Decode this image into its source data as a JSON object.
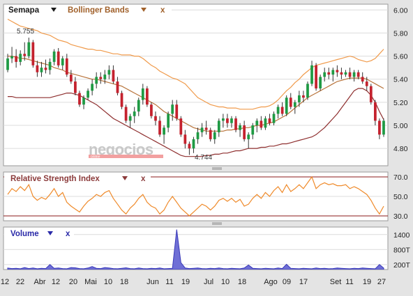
{
  "colors": {
    "bg": "#e4e4e4",
    "panel": "#ffffff",
    "grid": "#dcdcdc",
    "frame": "#9a9a9a",
    "upper_band": "#f09a4a",
    "middle_band": "#b8733a",
    "lower_band": "#8e2e2e",
    "up": "#1f9a44",
    "down": "#c4222e",
    "rsi": "#ef8a2a",
    "rsi_ref": "#8b1a1a",
    "volume": "#3a3ab8",
    "volume_fill": "#6f6fd6",
    "watermark_main": "#c8c8c8",
    "watermark_bar": "#f2a0a0"
  },
  "price_panel": {
    "legend": {
      "symbol": "Semapa",
      "indicator": "Bollinger Bands",
      "close": "x",
      "symbol_arrow": "chevron-down-icon",
      "indicator_arrow": "chevron-down-icon"
    },
    "ticks": [
      "6.00",
      "5.80",
      "5.60",
      "5.40",
      "5.20",
      "5.00",
      "4.80"
    ],
    "high_label": "5.755",
    "low_label": "4.744",
    "watermark": "negocios",
    "watermark_sub": "online"
  },
  "rsi_panel": {
    "legend": {
      "name": "Relative Strength Index",
      "close": "x",
      "arrow": "chevron-down-icon"
    },
    "ticks": [
      "70.0",
      "50.0",
      "30.0"
    ]
  },
  "volume_panel": {
    "legend": {
      "name": "Volume",
      "close": "x",
      "arrow": "chevron-down-icon"
    },
    "ticks": [
      "1400",
      "800T",
      "200T"
    ]
  },
  "x_axis": {
    "ticks": [
      "12",
      "22",
      "Abr",
      "12",
      "20",
      "Mai",
      "10",
      "18",
      "Jun",
      "11",
      "19",
      "Jul",
      "10",
      "18",
      "Ago",
      "09",
      "17",
      "Set",
      "11",
      "19",
      "27"
    ]
  },
  "chart_data": {
    "type": "candlestick",
    "y_range": [
      4.65,
      6.05
    ],
    "rsi_range": [
      25,
      75
    ],
    "rsi_reference_levels": [
      70,
      30
    ],
    "volume_range": [
      0,
      1700
    ],
    "candles": [
      [
        5.48,
        5.62,
        5.46,
        5.58
      ],
      [
        5.58,
        5.68,
        5.54,
        5.6
      ],
      [
        5.6,
        5.66,
        5.5,
        5.55
      ],
      [
        5.55,
        5.65,
        5.52,
        5.62
      ],
      [
        5.62,
        5.72,
        5.56,
        5.6
      ],
      [
        5.6,
        5.76,
        5.58,
        5.72
      ],
      [
        5.72,
        5.74,
        5.5,
        5.52
      ],
      [
        5.52,
        5.56,
        5.42,
        5.46
      ],
      [
        5.46,
        5.55,
        5.42,
        5.5
      ],
      [
        5.5,
        5.57,
        5.45,
        5.48
      ],
      [
        5.48,
        5.58,
        5.44,
        5.55
      ],
      [
        5.55,
        5.66,
        5.52,
        5.64
      ],
      [
        5.64,
        5.67,
        5.5,
        5.52
      ],
      [
        5.52,
        5.6,
        5.48,
        5.58
      ],
      [
        5.58,
        5.62,
        5.42,
        5.44
      ],
      [
        5.44,
        5.48,
        5.36,
        5.38
      ],
      [
        5.38,
        5.42,
        5.26,
        5.28
      ],
      [
        5.28,
        5.3,
        5.16,
        5.18
      ],
      [
        5.18,
        5.26,
        5.14,
        5.24
      ],
      [
        5.24,
        5.32,
        5.22,
        5.3
      ],
      [
        5.3,
        5.4,
        5.26,
        5.36
      ],
      [
        5.36,
        5.46,
        5.32,
        5.42
      ],
      [
        5.42,
        5.46,
        5.36,
        5.4
      ],
      [
        5.4,
        5.48,
        5.36,
        5.44
      ],
      [
        5.44,
        5.52,
        5.4,
        5.48
      ],
      [
        5.48,
        5.52,
        5.36,
        5.38
      ],
      [
        5.38,
        5.42,
        5.26,
        5.28
      ],
      [
        5.28,
        5.3,
        5.14,
        5.16
      ],
      [
        5.16,
        5.18,
        5.02,
        5.04
      ],
      [
        5.04,
        5.1,
        4.98,
        5.08
      ],
      [
        5.08,
        5.16,
        5.02,
        5.12
      ],
      [
        5.12,
        5.24,
        5.08,
        5.22
      ],
      [
        5.22,
        5.36,
        5.18,
        5.32
      ],
      [
        5.32,
        5.34,
        5.16,
        5.18
      ],
      [
        5.18,
        5.2,
        5.06,
        5.08
      ],
      [
        5.08,
        5.12,
        5.0,
        5.04
      ],
      [
        5.04,
        5.08,
        4.9,
        4.92
      ],
      [
        4.92,
        5.0,
        4.84,
        4.98
      ],
      [
        4.98,
        5.12,
        4.94,
        5.1
      ],
      [
        5.1,
        5.22,
        5.04,
        5.18
      ],
      [
        5.18,
        5.22,
        5.04,
        5.06
      ],
      [
        5.06,
        5.08,
        4.9,
        4.92
      ],
      [
        4.92,
        4.96,
        4.8,
        4.84
      ],
      [
        4.84,
        4.86,
        4.744,
        4.8
      ],
      [
        4.8,
        4.9,
        4.76,
        4.88
      ],
      [
        4.88,
        4.98,
        4.84,
        4.94
      ],
      [
        4.94,
        5.02,
        4.9,
        4.98
      ],
      [
        4.98,
        5.04,
        4.92,
        4.96
      ],
      [
        4.96,
        4.98,
        4.86,
        4.88
      ],
      [
        4.88,
        4.96,
        4.84,
        4.94
      ],
      [
        4.94,
        5.06,
        4.9,
        5.04
      ],
      [
        5.04,
        5.1,
        4.98,
        5.06
      ],
      [
        5.06,
        5.1,
        4.98,
        5.02
      ],
      [
        5.02,
        5.08,
        4.98,
        5.06
      ],
      [
        5.06,
        5.08,
        4.94,
        4.96
      ],
      [
        4.96,
        5.02,
        4.9,
        5.0
      ],
      [
        5.0,
        5.04,
        4.86,
        4.88
      ],
      [
        4.88,
        4.94,
        4.8,
        4.92
      ],
      [
        4.92,
        5.02,
        4.88,
        5.0
      ],
      [
        5.0,
        5.06,
        4.94,
        5.04
      ],
      [
        5.04,
        5.08,
        4.96,
        4.98
      ],
      [
        4.98,
        5.08,
        4.96,
        5.06
      ],
      [
        5.06,
        5.1,
        5.0,
        5.02
      ],
      [
        5.02,
        5.12,
        5.0,
        5.1
      ],
      [
        5.1,
        5.18,
        5.06,
        5.16
      ],
      [
        5.16,
        5.2,
        5.08,
        5.1
      ],
      [
        5.1,
        5.26,
        5.08,
        5.24
      ],
      [
        5.24,
        5.28,
        5.14,
        5.16
      ],
      [
        5.16,
        5.22,
        5.1,
        5.2
      ],
      [
        5.2,
        5.3,
        5.16,
        5.26
      ],
      [
        5.26,
        5.3,
        5.2,
        5.24
      ],
      [
        5.24,
        5.38,
        5.22,
        5.36
      ],
      [
        5.36,
        5.56,
        5.34,
        5.52
      ],
      [
        5.52,
        5.54,
        5.3,
        5.32
      ],
      [
        5.32,
        5.44,
        5.3,
        5.42
      ],
      [
        5.42,
        5.5,
        5.38,
        5.46
      ],
      [
        5.46,
        5.5,
        5.4,
        5.44
      ],
      [
        5.44,
        5.5,
        5.38,
        5.48
      ],
      [
        5.48,
        5.52,
        5.42,
        5.46
      ],
      [
        5.46,
        5.5,
        5.4,
        5.44
      ],
      [
        5.44,
        5.48,
        5.42,
        5.46
      ],
      [
        5.46,
        5.5,
        5.4,
        5.42
      ],
      [
        5.42,
        5.48,
        5.38,
        5.46
      ],
      [
        5.46,
        5.48,
        5.4,
        5.42
      ],
      [
        5.42,
        5.46,
        5.36,
        5.38
      ],
      [
        5.38,
        5.42,
        5.3,
        5.34
      ],
      [
        5.34,
        5.36,
        5.18,
        5.2
      ],
      [
        5.2,
        5.22,
        5.0,
        5.04
      ],
      [
        5.04,
        5.06,
        4.88,
        4.92
      ],
      [
        4.92,
        5.06,
        4.9,
        5.04
      ]
    ],
    "upper_band": [
      5.92,
      5.9,
      5.88,
      5.86,
      5.85,
      5.84,
      5.83,
      5.82,
      5.8,
      5.79,
      5.78,
      5.76,
      5.74,
      5.73,
      5.72,
      5.7,
      5.69,
      5.68,
      5.67,
      5.66,
      5.66,
      5.65,
      5.65,
      5.64,
      5.63,
      5.62,
      5.62,
      5.61,
      5.61,
      5.61,
      5.6,
      5.6,
      5.58,
      5.55,
      5.52,
      5.5,
      5.47,
      5.45,
      5.43,
      5.41,
      5.4,
      5.38,
      5.36,
      5.32,
      5.28,
      5.24,
      5.22,
      5.2,
      5.18,
      5.17,
      5.16,
      5.16,
      5.15,
      5.15,
      5.15,
      5.14,
      5.14,
      5.14,
      5.14,
      5.15,
      5.16,
      5.16,
      5.17,
      5.19,
      5.22,
      5.26,
      5.3,
      5.33,
      5.37,
      5.4,
      5.44,
      5.47,
      5.5,
      5.52,
      5.53,
      5.54,
      5.55,
      5.56,
      5.57,
      5.58,
      5.59,
      5.6,
      5.59,
      5.57,
      5.56,
      5.55,
      5.56,
      5.58,
      5.62,
      5.66
    ],
    "middle_band": [
      5.6,
      5.6,
      5.59,
      5.58,
      5.58,
      5.57,
      5.56,
      5.55,
      5.54,
      5.53,
      5.52,
      5.5,
      5.49,
      5.48,
      5.46,
      5.45,
      5.44,
      5.43,
      5.42,
      5.41,
      5.4,
      5.4,
      5.39,
      5.38,
      5.37,
      5.36,
      5.35,
      5.34,
      5.32,
      5.3,
      5.28,
      5.26,
      5.24,
      5.22,
      5.2,
      5.18,
      5.15,
      5.12,
      5.1,
      5.08,
      5.06,
      5.04,
      5.02,
      5.0,
      4.98,
      4.97,
      4.96,
      4.95,
      4.95,
      4.95,
      4.95,
      4.95,
      4.96,
      4.96,
      4.97,
      4.97,
      4.98,
      4.98,
      4.99,
      5.0,
      5.0,
      5.01,
      5.02,
      5.03,
      5.05,
      5.07,
      5.09,
      5.12,
      5.15,
      5.18,
      5.21,
      5.24,
      5.26,
      5.28,
      5.3,
      5.32,
      5.34,
      5.36,
      5.38,
      5.39,
      5.4,
      5.41,
      5.41,
      5.41,
      5.41,
      5.4,
      5.38,
      5.36,
      5.34,
      5.32
    ],
    "lower_band": [
      5.25,
      5.25,
      5.24,
      5.24,
      5.24,
      5.24,
      5.24,
      5.24,
      5.24,
      5.24,
      5.24,
      5.25,
      5.26,
      5.27,
      5.28,
      5.28,
      5.27,
      5.26,
      5.24,
      5.22,
      5.2,
      5.18,
      5.15,
      5.12,
      5.09,
      5.06,
      5.04,
      5.02,
      5.0,
      4.98,
      4.96,
      4.94,
      4.92,
      4.9,
      4.88,
      4.86,
      4.84,
      4.82,
      4.8,
      4.78,
      4.76,
      4.74,
      4.73,
      4.73,
      4.73,
      4.73,
      4.73,
      4.74,
      4.74,
      4.75,
      4.75,
      4.76,
      4.76,
      4.77,
      4.78,
      4.78,
      4.79,
      4.8,
      4.8,
      4.8,
      4.81,
      4.81,
      4.82,
      4.82,
      4.83,
      4.84,
      4.84,
      4.85,
      4.86,
      4.87,
      4.88,
      4.89,
      4.9,
      4.92,
      4.95,
      4.98,
      5.02,
      5.06,
      5.1,
      5.15,
      5.2,
      5.25,
      5.3,
      5.32,
      5.32,
      5.3,
      5.26,
      5.2,
      5.12,
      5.05
    ],
    "rsi": [
      52,
      58,
      55,
      60,
      56,
      62,
      50,
      46,
      49,
      47,
      52,
      58,
      50,
      54,
      44,
      40,
      37,
      34,
      40,
      45,
      48,
      52,
      50,
      54,
      56,
      48,
      42,
      36,
      32,
      38,
      42,
      48,
      52,
      44,
      40,
      38,
      32,
      36,
      44,
      50,
      44,
      38,
      34,
      30,
      34,
      38,
      42,
      40,
      36,
      40,
      46,
      48,
      45,
      48,
      44,
      47,
      40,
      42,
      48,
      52,
      48,
      54,
      50,
      56,
      60,
      54,
      62,
      55,
      58,
      62,
      58,
      64,
      70,
      58,
      62,
      64,
      62,
      63,
      61,
      61,
      62,
      58,
      60,
      58,
      55,
      52,
      46,
      38,
      32,
      40
    ],
    "volume": [
      60,
      40,
      50,
      30,
      80,
      40,
      60,
      30,
      50,
      40,
      200,
      50,
      60,
      40,
      30,
      80,
      70,
      40,
      30,
      60,
      120,
      50,
      40,
      80,
      60,
      40,
      30,
      50,
      70,
      40,
      30,
      60,
      40,
      30,
      50,
      40,
      60,
      30,
      40,
      50,
      1600,
      280,
      60,
      40,
      50,
      60,
      40,
      30,
      50,
      40,
      60,
      40,
      30,
      50,
      40,
      30,
      60,
      180,
      50,
      40,
      30,
      50,
      40,
      30,
      60,
      40,
      210,
      50,
      40,
      30,
      50,
      40,
      30,
      60,
      40,
      50,
      30,
      40,
      60,
      50,
      40,
      30,
      50,
      40,
      60,
      50,
      40,
      30,
      200,
      60
    ]
  }
}
